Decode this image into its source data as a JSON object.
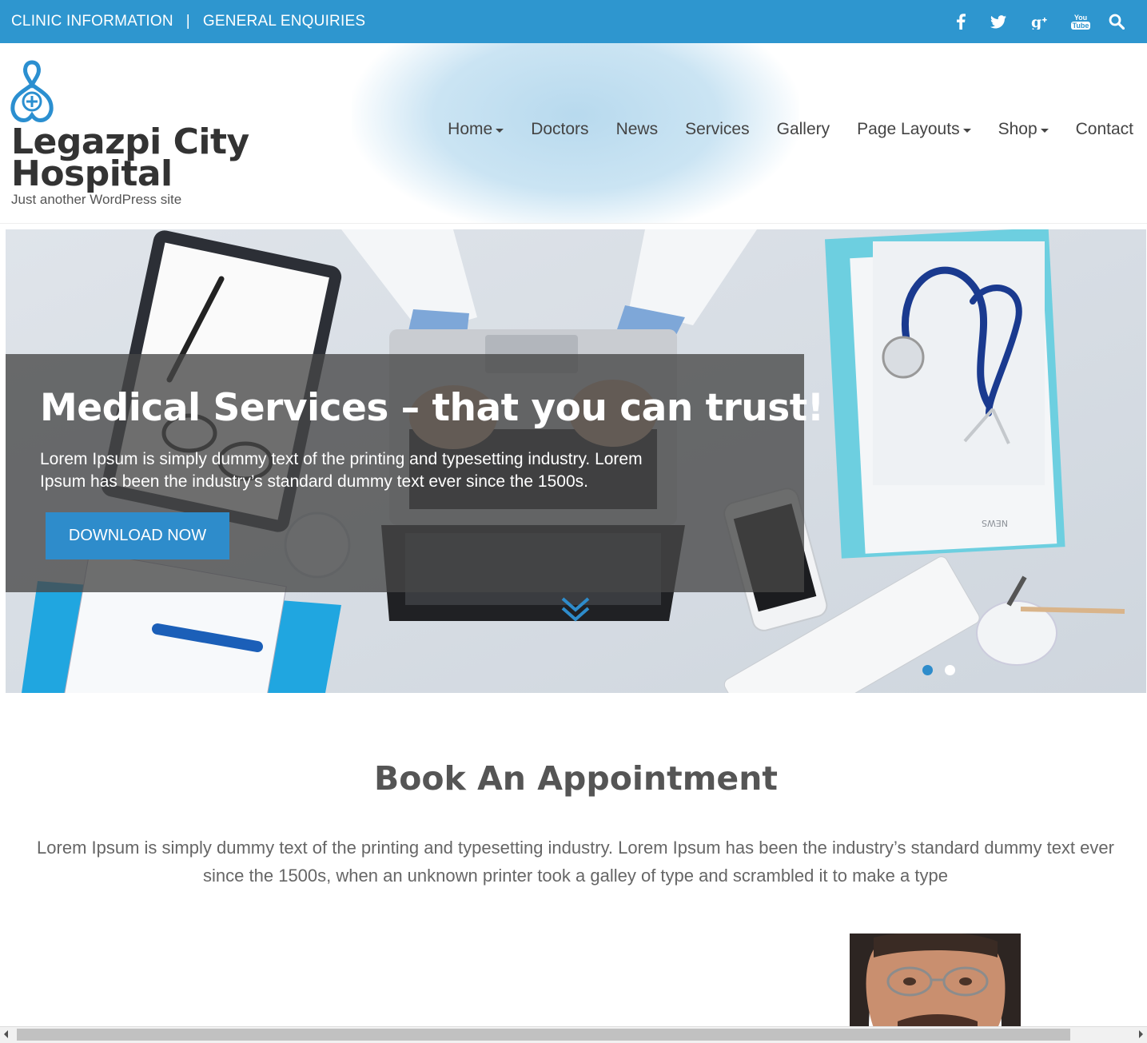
{
  "topbar": {
    "link_clinic": "CLINIC INFORMATION",
    "separator": "|",
    "link_enquiries": "GENERAL ENQUIRIES",
    "social_icons": [
      "facebook-icon",
      "twitter-icon",
      "google-plus-icon",
      "youtube-icon",
      "search-icon"
    ],
    "youtube_label_1": "You",
    "youtube_label_2": "Tube"
  },
  "header": {
    "site_title_line1": "Legazpi City",
    "site_title_line2": "Hospital",
    "tagline": "Just another WordPress site"
  },
  "nav": {
    "items": [
      {
        "label": "Home",
        "has_dropdown": true
      },
      {
        "label": "Doctors",
        "has_dropdown": false
      },
      {
        "label": "News",
        "has_dropdown": false
      },
      {
        "label": "Services",
        "has_dropdown": false
      },
      {
        "label": "Gallery",
        "has_dropdown": false
      },
      {
        "label": "Page Layouts",
        "has_dropdown": true
      },
      {
        "label": "Shop",
        "has_dropdown": true
      },
      {
        "label": "Contact",
        "has_dropdown": false
      }
    ]
  },
  "hero": {
    "title": "Medical Services – that you can trust!",
    "text_line1": "Lorem Ipsum is simply dummy text of the printing and typesetting industry. Lorem",
    "text_line2": "Ipsum has been the industry’s standard dummy text ever since the 1500s.",
    "button_label": "DOWNLOAD NOW",
    "folder_label": "NEWS",
    "slides_total": 2,
    "active_slide": 1
  },
  "appointment": {
    "title": "Book An Appointment",
    "text_line1": "Lorem Ipsum is simply dummy text of the printing and typesetting industry. Lorem Ipsum has been the industry’s standard dummy text ever",
    "text_line2": "since the 1500s, when an unknown printer took a galley of type and scrambled it to make a type"
  },
  "colors": {
    "brand_blue": "#2e96cf",
    "button_blue": "#2e8ccb",
    "text_dark": "#333333"
  }
}
